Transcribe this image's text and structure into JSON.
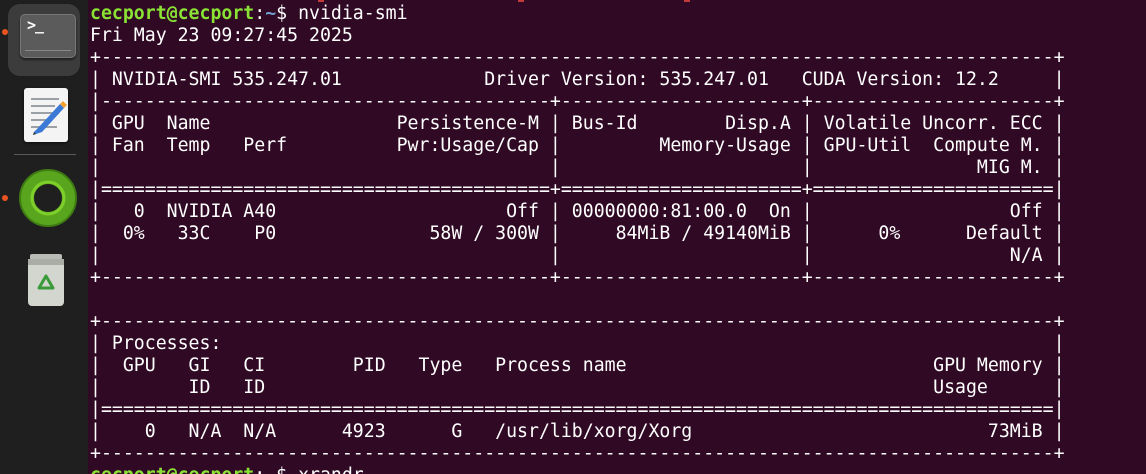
{
  "dock": {
    "items": [
      {
        "name": "terminal",
        "prompt_glyph": ">_",
        "running": true,
        "active": true
      },
      {
        "name": "text-editor",
        "running": false
      },
      {
        "name": "green-app",
        "running": true
      },
      {
        "name": "trash",
        "running": false
      }
    ]
  },
  "terminal": {
    "prompt": {
      "user_host": "cecport@cecport",
      "path": "~",
      "symbol": "$ "
    },
    "command": "nvidia-smi",
    "date_line": "Fri May 23 09:27:45 2025",
    "table": [
      "+---------------------------------------------------------------------------------------+",
      "| NVIDIA-SMI 535.247.01             Driver Version: 535.247.01   CUDA Version: 12.2     |",
      "|-----------------------------------------+----------------------+----------------------+",
      "| GPU  Name                 Persistence-M | Bus-Id        Disp.A | Volatile Uncorr. ECC |",
      "| Fan  Temp   Perf          Pwr:Usage/Cap |         Memory-Usage | GPU-Util  Compute M. |",
      "|                                         |                      |               MIG M. |",
      "|=========================================+======================+======================|",
      "|   0  NVIDIA A40                     Off | 00000000:81:00.0  On |                  Off |",
      "|  0%   33C    P0              58W / 300W |     84MiB / 49140MiB |      0%      Default |",
      "|                                         |                      |                  N/A |",
      "+-----------------------------------------+----------------------+----------------------+",
      "",
      "+---------------------------------------------------------------------------------------+",
      "| Processes:                                                                            |",
      "|  GPU   GI   CI        PID   Type   Process name                            GPU Memory |",
      "|        ID   ID                                                             Usage      |",
      "|=======================================================================================|",
      "|    0   N/A  N/A      4923      G   /usr/lib/xorg/Xorg                           73MiB |",
      "+---------------------------------------------------------------------------------------+"
    ],
    "next_prompt": {
      "user_host": "cecport@cecport",
      "path": "~",
      "symbol": "$ ",
      "command": "xrandr"
    }
  },
  "colors": {
    "terminal_bg": "#300a24",
    "dock_bg": "#1f1f1f",
    "prompt_user": "#8ae234",
    "prompt_path": "#729fcf",
    "running_indicator": "#e95420"
  }
}
